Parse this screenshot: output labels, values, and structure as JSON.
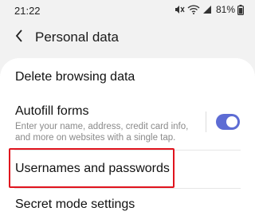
{
  "status_bar": {
    "time": "21:22",
    "battery": "81%"
  },
  "app_bar": {
    "title": "Personal data"
  },
  "items": [
    {
      "label": "Delete browsing data"
    },
    {
      "label": "Autofill forms",
      "subtitle": "Enter your name, address, credit card info, and more on websites with a single tap.",
      "toggle_on": true
    },
    {
      "label": "Usernames and passwords",
      "highlighted": true
    },
    {
      "label": "Secret mode settings"
    }
  ],
  "colors": {
    "accent": "#5d6cd4",
    "highlight": "#e0141e",
    "background": "#f2f2f2"
  }
}
